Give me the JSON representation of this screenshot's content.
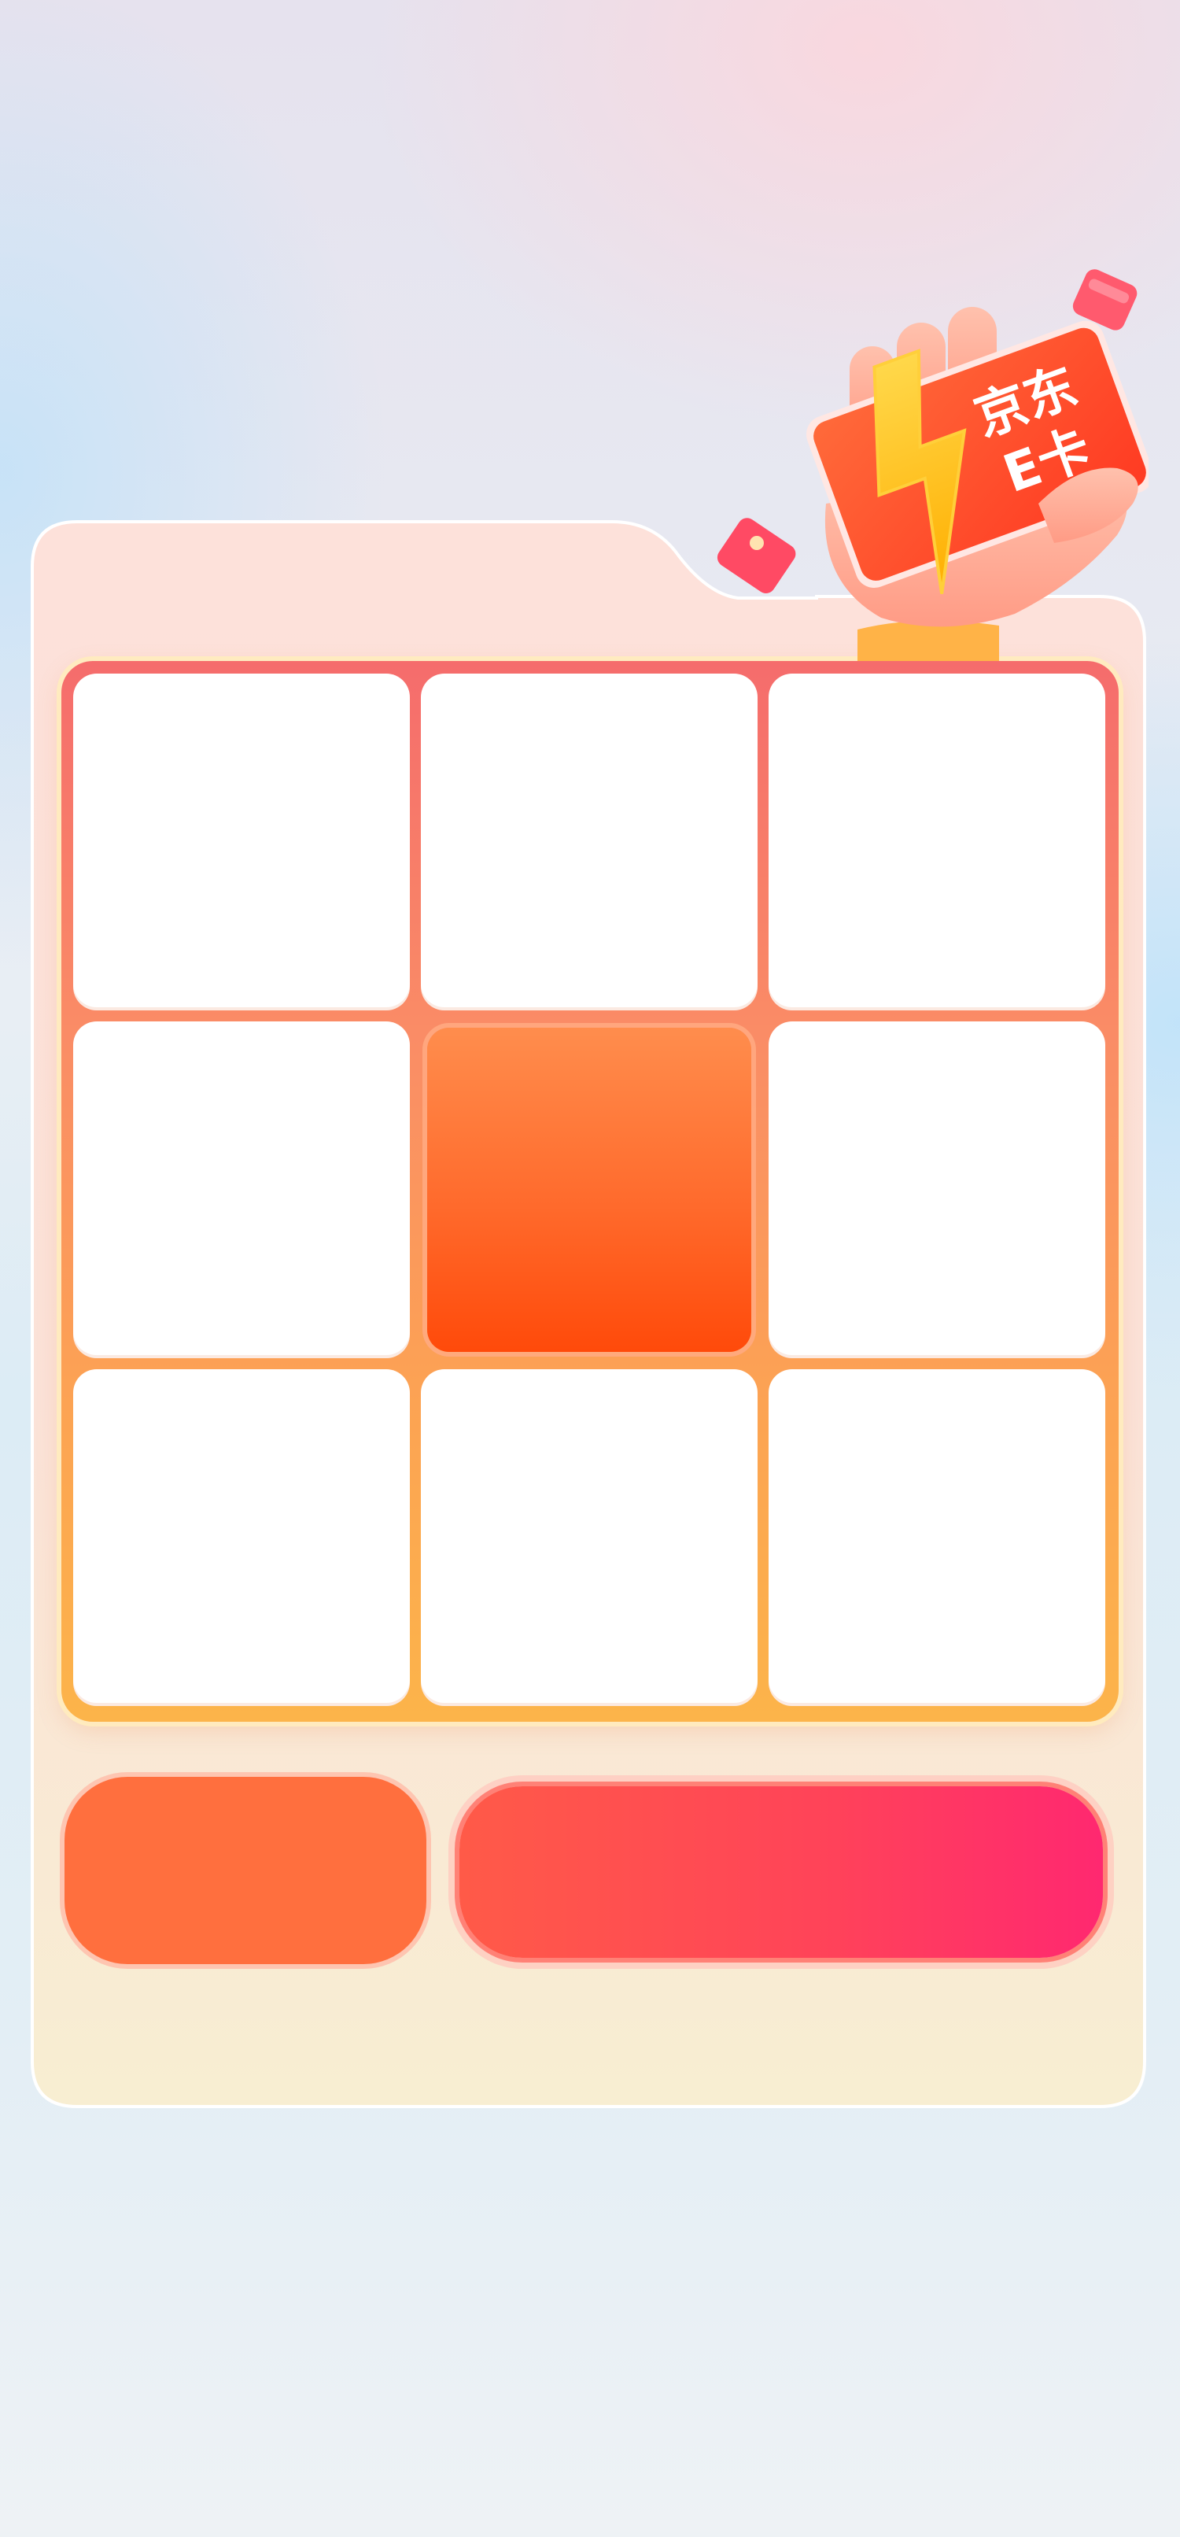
{
  "promo_card": {
    "line1": "京东",
    "line2": "E卡"
  },
  "grid": {
    "rows": 3,
    "cols": 3,
    "active_cell": 4
  },
  "colors": {
    "accent_orange": "#ff6f3e",
    "accent_pink": "#ff2870",
    "card_red": "#ff4b2b",
    "bolt_yellow": "#ffc21a"
  }
}
